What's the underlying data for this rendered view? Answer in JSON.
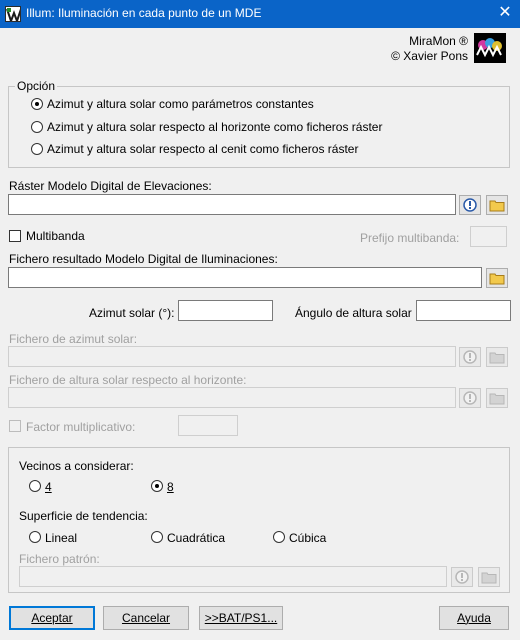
{
  "window": {
    "title": "Illum: Iluminación en cada punto de un MDE",
    "close_glyph": "✕"
  },
  "brand": {
    "name": "MiraMon ®",
    "author": "© Xavier Pons"
  },
  "option_group": {
    "legend": "Opción",
    "options": [
      {
        "label": "Azimut y altura solar como parámetros constantes",
        "selected": true
      },
      {
        "label": "Azimut y altura solar respecto al horizonte como ficheros ráster",
        "selected": false
      },
      {
        "label": "Azimut y altura solar respecto al cenit como ficheros ráster",
        "selected": false
      }
    ]
  },
  "dem": {
    "label": "Ráster Modelo Digital de Elevaciones:",
    "value": ""
  },
  "multiband": {
    "label": "Multibanda",
    "checked": false,
    "prefix_label": "Prefijo multibanda:",
    "prefix_value": ""
  },
  "result": {
    "label": "Fichero resultado Modelo Digital de Iluminaciones:",
    "value": ""
  },
  "sun": {
    "azimuth_label": "Azimut solar (°):",
    "azimuth_value": "",
    "altitude_label": "Ángulo de altura solar",
    "altitude_value": ""
  },
  "azimuth_file": {
    "label": "Fichero de azimut solar:",
    "value": ""
  },
  "altitude_file": {
    "label": "Fichero de altura solar respecto al horizonte:",
    "value": ""
  },
  "factor": {
    "label": "Factor multiplicativo:",
    "checked": false,
    "value": ""
  },
  "neighbors": {
    "label": "Vecinos a considerar:",
    "options": [
      {
        "label": "4",
        "selected": false
      },
      {
        "label": "8",
        "selected": true
      }
    ]
  },
  "trend": {
    "label": "Superficie de tendencia:",
    "options": [
      {
        "label": "Lineal",
        "selected": false
      },
      {
        "label": "Cuadrática",
        "selected": false
      },
      {
        "label": "Cúbica",
        "selected": false
      }
    ]
  },
  "pattern_file": {
    "label": "Fichero patrón:",
    "value": ""
  },
  "buttons": {
    "accept": "Aceptar",
    "cancel": "Cancelar",
    "bat": ">>BAT/PS1...",
    "help": "Ayuda"
  },
  "icons": {
    "app": "miramon-app-icon",
    "logo": "miramon-logo",
    "metadata": "metadata-icon",
    "folder": "folder-icon"
  },
  "colors": {
    "titlebar": "#0a64c8",
    "default_button_border": "#0078d7",
    "disabled_text": "#a0a0a0"
  }
}
